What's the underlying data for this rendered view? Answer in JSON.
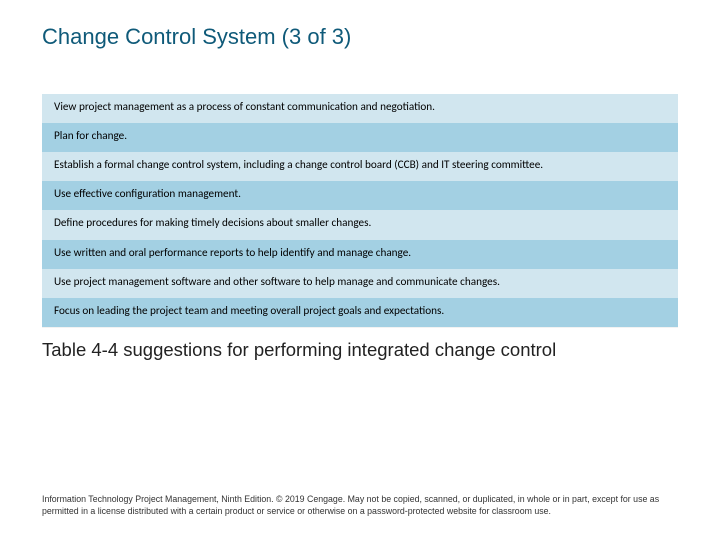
{
  "title": "Change Control System (3 of 3)",
  "rows": [
    "View project management as a process of constant communication and negotiation.",
    "Plan for change.",
    "Establish a formal change control system, including a change control board (CCB) and IT steering committee.",
    "Use effective configuration management.",
    "Define procedures for making timely decisions about smaller changes.",
    "Use written and oral performance reports to help identify and manage change.",
    "Use project management software and other software to help manage and communicate changes.",
    "Focus on leading the project team and meeting overall project goals and expectations."
  ],
  "caption": "Table 4-4 suggestions for performing integrated change control",
  "footer": "Information Technology Project Management, Ninth Edition. © 2019 Cengage. May not be copied, scanned, or duplicated, in whole or in part, except for use as permitted in a license distributed with a certain product or service or otherwise on a password-protected website for classroom use."
}
